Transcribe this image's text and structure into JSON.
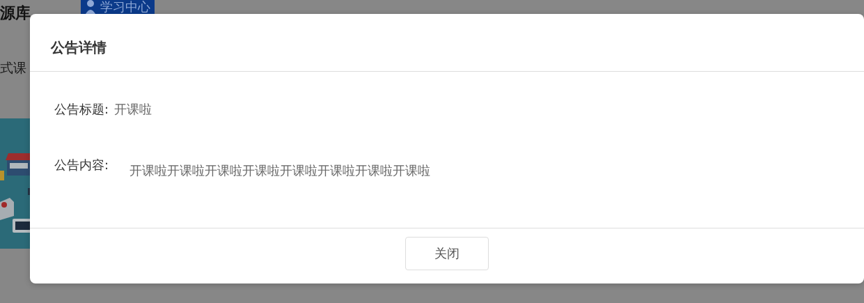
{
  "page": {
    "site_title": "源库",
    "study_center_button": "学习中心",
    "course_tab": "式课"
  },
  "dialog": {
    "title": "公告详情",
    "fields": [
      {
        "label": "公告标题:",
        "value": "开课啦"
      },
      {
        "label": "公告内容:",
        "value": "开课啦开课啦开课啦开课啦开课啦开课啦开课啦开课啦"
      }
    ],
    "buttons": [
      "关闭"
    ]
  }
}
